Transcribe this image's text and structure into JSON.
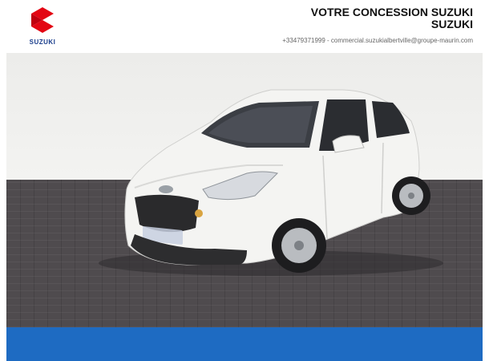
{
  "brand": {
    "logo_text": "SUZUKI",
    "logo_color": "#e30613"
  },
  "header": {
    "title_line1": "VOTRE CONCESSION SUZUKI",
    "title_line2": "SUZUKI",
    "contact": "+33479371999  -  commercial.suzukialbertville@groupe-maurin.com"
  },
  "colors": {
    "accent_bar": "#1e6bc2",
    "floor": "#4f4b4e",
    "car_body": "#f4f4f2"
  }
}
